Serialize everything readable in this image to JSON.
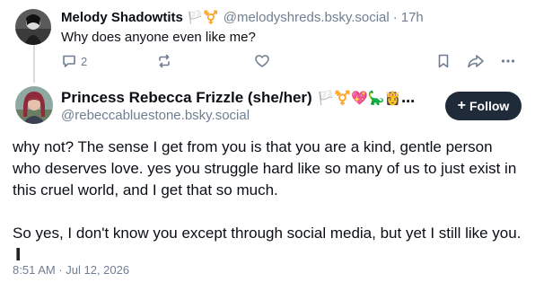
{
  "parent_post": {
    "author_name": "Melody Shadowtits",
    "author_flags": "🏳️⚧️",
    "handle": "@melodyshreds.bsky.social",
    "separator": "·",
    "time": "17h",
    "text": "Why does anyone even like me?",
    "reply_count": "2",
    "icons": {
      "reply": "reply-icon",
      "repost": "repost-icon",
      "like": "heart-icon",
      "bookmark": "bookmark-icon",
      "share": "share-icon",
      "more": "more-icon"
    }
  },
  "main_post": {
    "author_name": "Princess Rebecca Frizzle (she/her)",
    "author_emoji": "🏳️⚧️💖🦕👸…",
    "handle": "@rebeccabluestone.bsky.social",
    "follow_label": "Follow",
    "follow_icon": "+",
    "paragraph_1": "why not? The sense I get from you is that you are a kind, gentle person who deserves love. yes you struggle hard like so many of us to just exist in this cruel world, and I get that so much.",
    "paragraph_2": "So yes, I don't know you except through social media, but yet I still like you.",
    "timestamp": "8:51 AM · Jul 12, 2026"
  },
  "colors": {
    "muted_text": "#6f7f91",
    "follow_button_bg": "#1f2b38",
    "thread_line": "#d4dbe2"
  }
}
